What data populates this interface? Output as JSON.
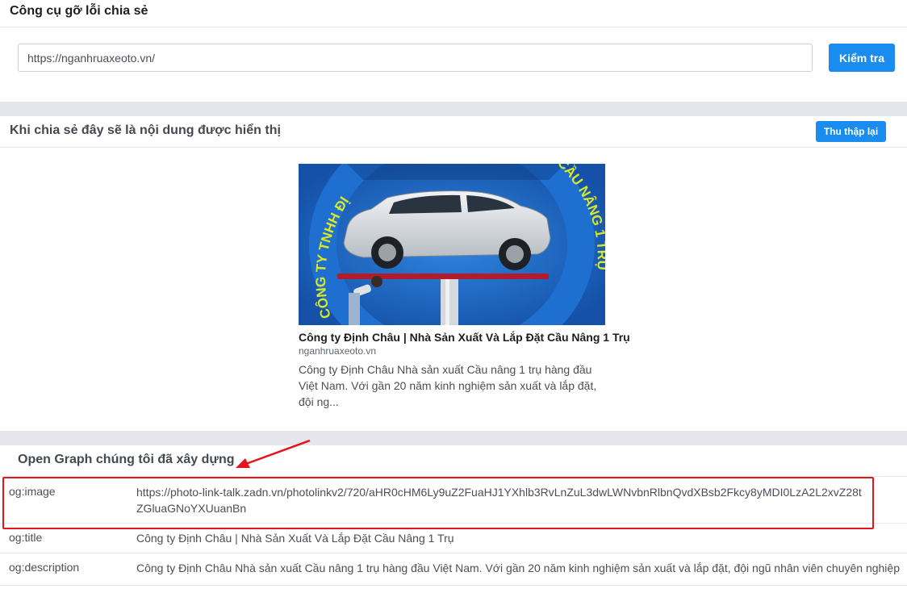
{
  "debugger": {
    "title": "Công cụ gỡ lỗi chia sẻ",
    "url_value": "https://nganhruaxeoto.vn/",
    "check_label": "Kiểm tra"
  },
  "preview": {
    "heading": "Khi chia sẻ đây sẽ là nội dung được hiển thị",
    "recollect_label": "Thu thập lại",
    "image": {
      "arc_text_left": "CÔNG TY TNHH ĐỊ",
      "arc_text_right": "CẦU NÂNG 1 TRỤ"
    },
    "card_title": "Công ty Định Châu | Nhà Sản Xuất Và Lắp Đặt Cầu Nâng 1 Trụ",
    "card_domain": "nganhruaxeoto.vn",
    "card_desc": "Công ty Định Châu Nhà sản xuất Cầu nâng 1 trụ hàng đầu Việt Nam. Với gần 20 năm kinh nghiệm sản xuất và lắp đặt, đội ng..."
  },
  "open_graph": {
    "heading": "Open Graph chúng tôi đã xây dựng",
    "rows": [
      {
        "key": "og:image",
        "value": "https://photo-link-talk.zadn.vn/photolinkv2/720/aHR0cHM6Ly9uZ2FuaHJ1YXhlb3RvLnZuL3dwLWNvbnRlbnQvdXBsb2Fkcy8yMDI0LzA2L2xvZ28tZGluaGNoYXUuanBn"
      },
      {
        "key": "og:title",
        "value": "Công ty Định Châu | Nhà Sản Xuất Và Lắp Đặt Cầu Nâng 1 Trụ"
      },
      {
        "key": "og:description",
        "value": "Công ty Định Châu Nhà sản xuất Cầu nâng 1 trụ hàng đầu Việt Nam. Với gần 20 năm kinh nghiệm sản xuất và lắp đặt, đội ngũ nhân viên chuyên nghiệp"
      }
    ]
  },
  "colors": {
    "accent": "#1a8cf0",
    "highlight": "#e4161b",
    "band": "#e4e6eb"
  }
}
